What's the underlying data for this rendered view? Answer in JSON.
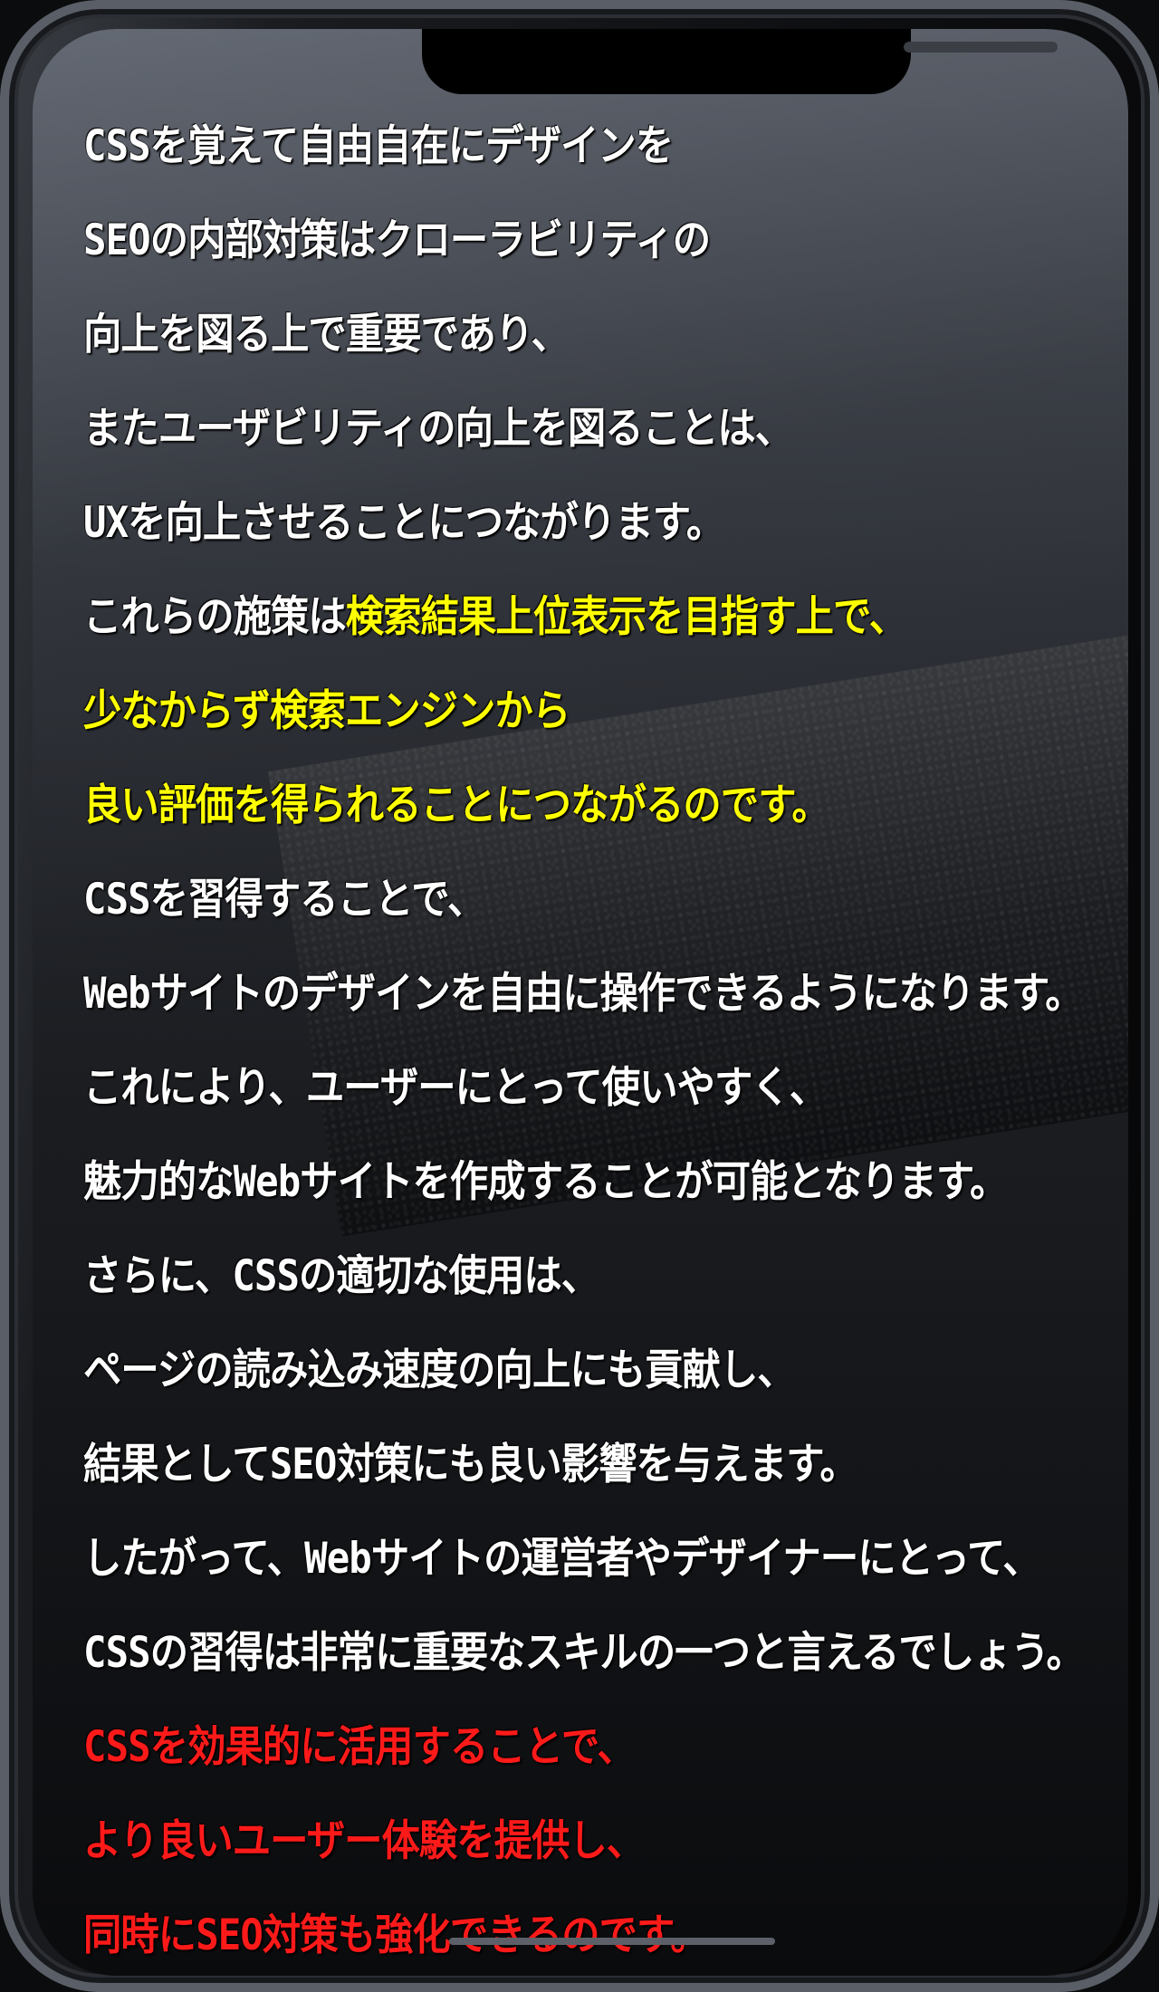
{
  "colors": {
    "text_default": "#ffffff",
    "text_highlight_yellow": "#ffff00",
    "text_highlight_red": "#ff1a1a"
  },
  "lines": [
    {
      "parts": [
        {
          "text": "CSSを覚えて自由自在にデザインを",
          "color": "white"
        }
      ]
    },
    {
      "parts": [
        {
          "text": "SEOの内部対策はクローラビリティの",
          "color": "white"
        }
      ]
    },
    {
      "parts": [
        {
          "text": "向上を図る上で重要であり、",
          "color": "white"
        }
      ]
    },
    {
      "parts": [
        {
          "text": "またユーザビリティの向上を図ることは、",
          "color": "white"
        }
      ]
    },
    {
      "parts": [
        {
          "text": "UXを向上させることにつながります。",
          "color": "white"
        }
      ]
    },
    {
      "parts": [
        {
          "text": "これらの施策は",
          "color": "white"
        },
        {
          "text": "検索結果上位表示を目指す上で、",
          "color": "yellow"
        }
      ]
    },
    {
      "parts": [
        {
          "text": "少なからず検索エンジンから",
          "color": "yellow"
        }
      ]
    },
    {
      "parts": [
        {
          "text": "良い評価を得られることにつながるのです。",
          "color": "yellow"
        }
      ]
    },
    {
      "parts": [
        {
          "text": "CSSを習得することで、",
          "color": "white"
        }
      ]
    },
    {
      "parts": [
        {
          "text": "Webサイトのデザインを自由に操作できるようになります。",
          "color": "white"
        }
      ]
    },
    {
      "parts": [
        {
          "text": "これにより、ユーザーにとって使いやすく、",
          "color": "white"
        }
      ]
    },
    {
      "parts": [
        {
          "text": "魅力的なWebサイトを作成することが可能となります。",
          "color": "white"
        }
      ]
    },
    {
      "parts": [
        {
          "text": "さらに、CSSの適切な使用は、",
          "color": "white"
        }
      ]
    },
    {
      "parts": [
        {
          "text": "ページの読み込み速度の向上にも貢献し、",
          "color": "white"
        }
      ]
    },
    {
      "parts": [
        {
          "text": "結果としてSEO対策にも良い影響を与えます。",
          "color": "white"
        }
      ]
    },
    {
      "parts": [
        {
          "text": "したがって、Webサイトの運営者やデザイナーにとって、",
          "color": "white"
        }
      ]
    },
    {
      "parts": [
        {
          "text": "CSSの習得は非常に重要なスキルの一つと言えるでしょう。",
          "color": "white"
        }
      ]
    },
    {
      "parts": [
        {
          "text": "CSSを効果的に活用することで、",
          "color": "red"
        }
      ]
    },
    {
      "parts": [
        {
          "text": "より良いユーザー体験を提供し、",
          "color": "red"
        }
      ]
    },
    {
      "parts": [
        {
          "text": "同時にSEO対策も強化できるのです。",
          "color": "red"
        }
      ]
    }
  ]
}
